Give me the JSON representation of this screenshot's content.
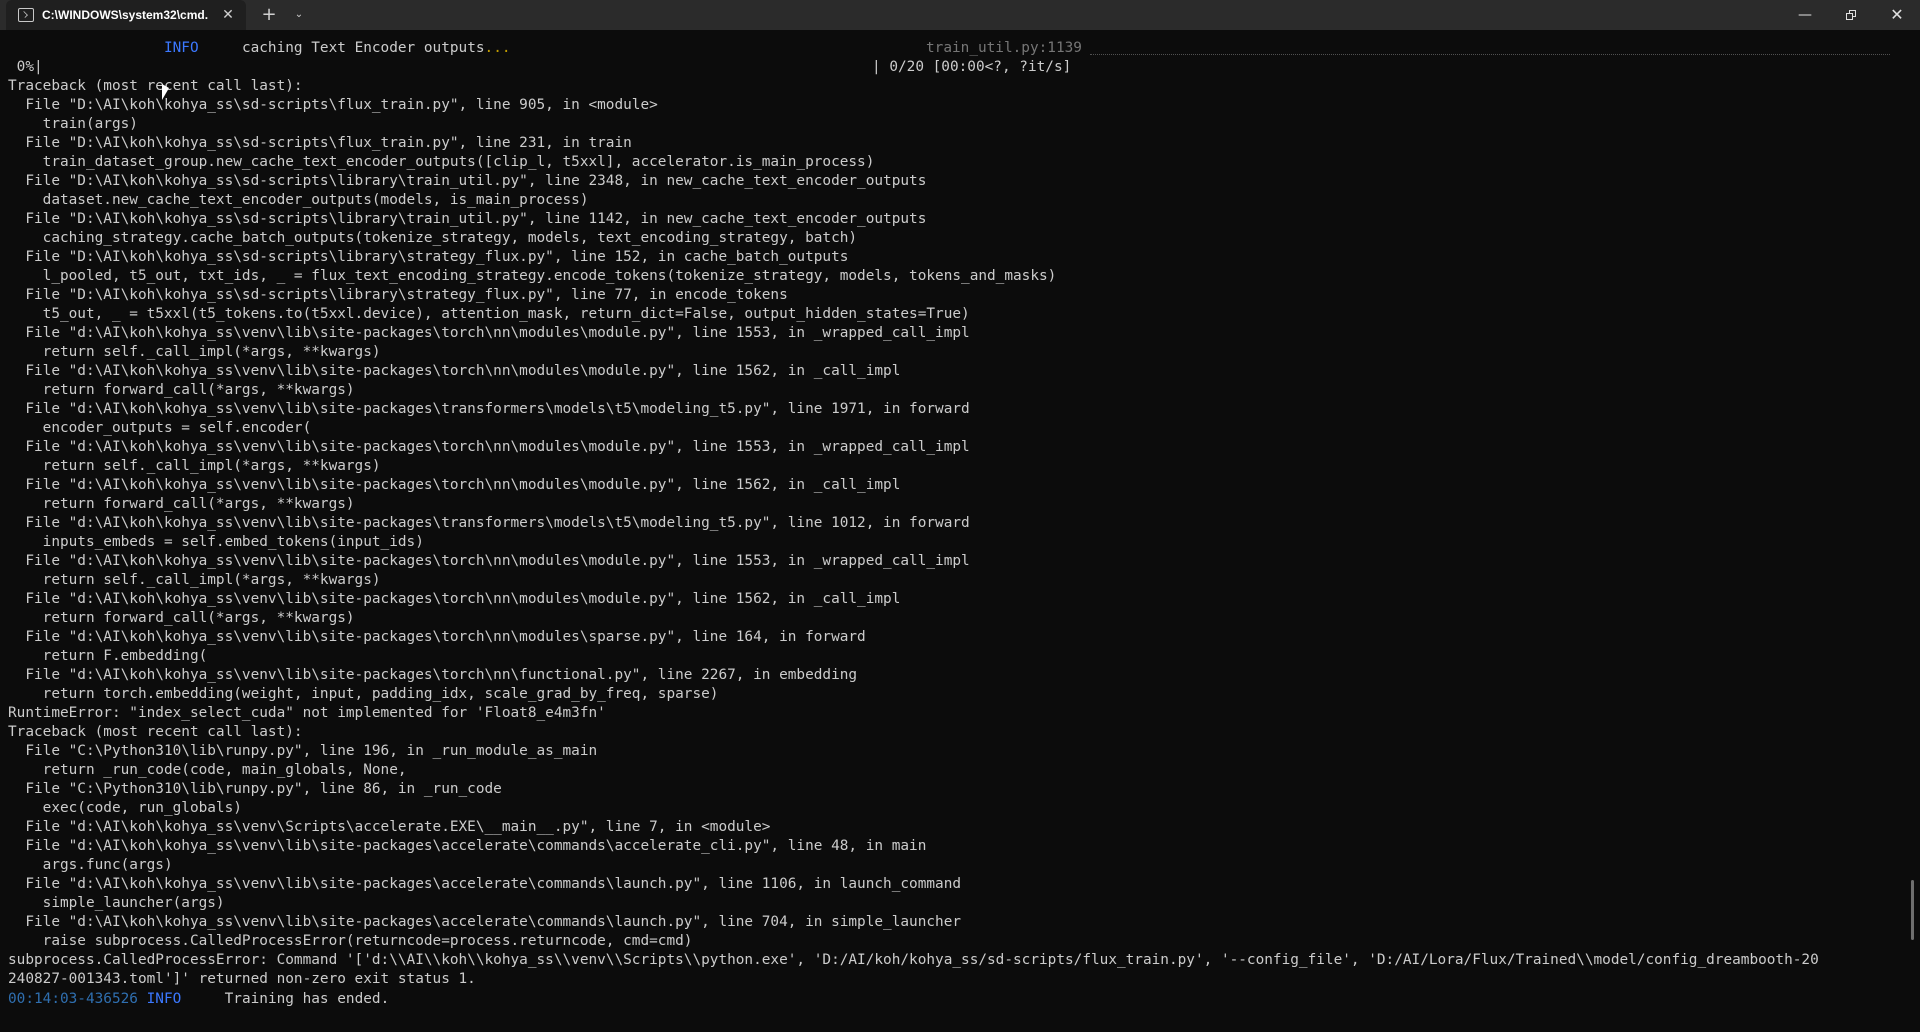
{
  "window": {
    "tab_title": "C:\\WINDOWS\\system32\\cmd.",
    "tab_close": "✕",
    "new_tab": "+",
    "dropdown": "⌄",
    "minimize": "—",
    "close": "✕"
  },
  "terminal": {
    "header": {
      "level": "INFO",
      "message": "caching Text Encoder outputs",
      "dots": "...",
      "source": "train_util.py:1139"
    },
    "progress": {
      "left": " 0%|",
      "right": "| 0/20 [00:00<?, ?it/s]"
    },
    "lines": [
      "Traceback (most recent call last):",
      "  File \"D:\\AI\\koh\\kohya_ss\\sd-scripts\\flux_train.py\", line 905, in <module>",
      "    train(args)",
      "  File \"D:\\AI\\koh\\kohya_ss\\sd-scripts\\flux_train.py\", line 231, in train",
      "    train_dataset_group.new_cache_text_encoder_outputs([clip_l, t5xxl], accelerator.is_main_process)",
      "  File \"D:\\AI\\koh\\kohya_ss\\sd-scripts\\library\\train_util.py\", line 2348, in new_cache_text_encoder_outputs",
      "    dataset.new_cache_text_encoder_outputs(models, is_main_process)",
      "  File \"D:\\AI\\koh\\kohya_ss\\sd-scripts\\library\\train_util.py\", line 1142, in new_cache_text_encoder_outputs",
      "    caching_strategy.cache_batch_outputs(tokenize_strategy, models, text_encoding_strategy, batch)",
      "  File \"D:\\AI\\koh\\kohya_ss\\sd-scripts\\library\\strategy_flux.py\", line 152, in cache_batch_outputs",
      "    l_pooled, t5_out, txt_ids, _ = flux_text_encoding_strategy.encode_tokens(tokenize_strategy, models, tokens_and_masks)",
      "  File \"D:\\AI\\koh\\kohya_ss\\sd-scripts\\library\\strategy_flux.py\", line 77, in encode_tokens",
      "    t5_out, _ = t5xxl(t5_tokens.to(t5xxl.device), attention_mask, return_dict=False, output_hidden_states=True)",
      "  File \"d:\\AI\\koh\\kohya_ss\\venv\\lib\\site-packages\\torch\\nn\\modules\\module.py\", line 1553, in _wrapped_call_impl",
      "    return self._call_impl(*args, **kwargs)",
      "  File \"d:\\AI\\koh\\kohya_ss\\venv\\lib\\site-packages\\torch\\nn\\modules\\module.py\", line 1562, in _call_impl",
      "    return forward_call(*args, **kwargs)",
      "  File \"d:\\AI\\koh\\kohya_ss\\venv\\lib\\site-packages\\transformers\\models\\t5\\modeling_t5.py\", line 1971, in forward",
      "    encoder_outputs = self.encoder(",
      "  File \"d:\\AI\\koh\\kohya_ss\\venv\\lib\\site-packages\\torch\\nn\\modules\\module.py\", line 1553, in _wrapped_call_impl",
      "    return self._call_impl(*args, **kwargs)",
      "  File \"d:\\AI\\koh\\kohya_ss\\venv\\lib\\site-packages\\torch\\nn\\modules\\module.py\", line 1562, in _call_impl",
      "    return forward_call(*args, **kwargs)",
      "  File \"d:\\AI\\koh\\kohya_ss\\venv\\lib\\site-packages\\transformers\\models\\t5\\modeling_t5.py\", line 1012, in forward",
      "    inputs_embeds = self.embed_tokens(input_ids)",
      "  File \"d:\\AI\\koh\\kohya_ss\\venv\\lib\\site-packages\\torch\\nn\\modules\\module.py\", line 1553, in _wrapped_call_impl",
      "    return self._call_impl(*args, **kwargs)",
      "  File \"d:\\AI\\koh\\kohya_ss\\venv\\lib\\site-packages\\torch\\nn\\modules\\module.py\", line 1562, in _call_impl",
      "    return forward_call(*args, **kwargs)",
      "  File \"d:\\AI\\koh\\kohya_ss\\venv\\lib\\site-packages\\torch\\nn\\modules\\sparse.py\", line 164, in forward",
      "    return F.embedding(",
      "  File \"d:\\AI\\koh\\kohya_ss\\venv\\lib\\site-packages\\torch\\nn\\functional.py\", line 2267, in embedding",
      "    return torch.embedding(weight, input, padding_idx, scale_grad_by_freq, sparse)",
      "RuntimeError: \"index_select_cuda\" not implemented for 'Float8_e4m3fn'",
      "Traceback (most recent call last):",
      "  File \"C:\\Python310\\lib\\runpy.py\", line 196, in _run_module_as_main",
      "    return _run_code(code, main_globals, None,",
      "  File \"C:\\Python310\\lib\\runpy.py\", line 86, in _run_code",
      "    exec(code, run_globals)",
      "  File \"d:\\AI\\koh\\kohya_ss\\venv\\Scripts\\accelerate.EXE\\__main__.py\", line 7, in <module>",
      "  File \"d:\\AI\\koh\\kohya_ss\\venv\\lib\\site-packages\\accelerate\\commands\\accelerate_cli.py\", line 48, in main",
      "    args.func(args)",
      "  File \"d:\\AI\\koh\\kohya_ss\\venv\\lib\\site-packages\\accelerate\\commands\\launch.py\", line 1106, in launch_command",
      "    simple_launcher(args)",
      "  File \"d:\\AI\\koh\\kohya_ss\\venv\\lib\\site-packages\\accelerate\\commands\\launch.py\", line 704, in simple_launcher",
      "    raise subprocess.CalledProcessError(returncode=process.returncode, cmd=cmd)",
      "subprocess.CalledProcessError: Command '['d:\\\\AI\\\\koh\\\\kohya_ss\\\\venv\\\\Scripts\\\\python.exe', 'D:/AI/koh/kohya_ss/sd-scripts/flux_train.py', '--config_file', 'D:/AI/Lora/Flux/Trained\\\\model/config_dreambooth-20",
      "240827-001343.toml']' returned non-zero exit status 1."
    ],
    "footer": {
      "timestamp": "00:14:03-436526",
      "level": "INFO",
      "message": "Training has ended."
    }
  },
  "colors": {
    "background": "#0c0c0c",
    "text": "#cccccc",
    "info": "#3b78ff",
    "timestamp": "#2f6fb0",
    "dim": "#767676"
  }
}
